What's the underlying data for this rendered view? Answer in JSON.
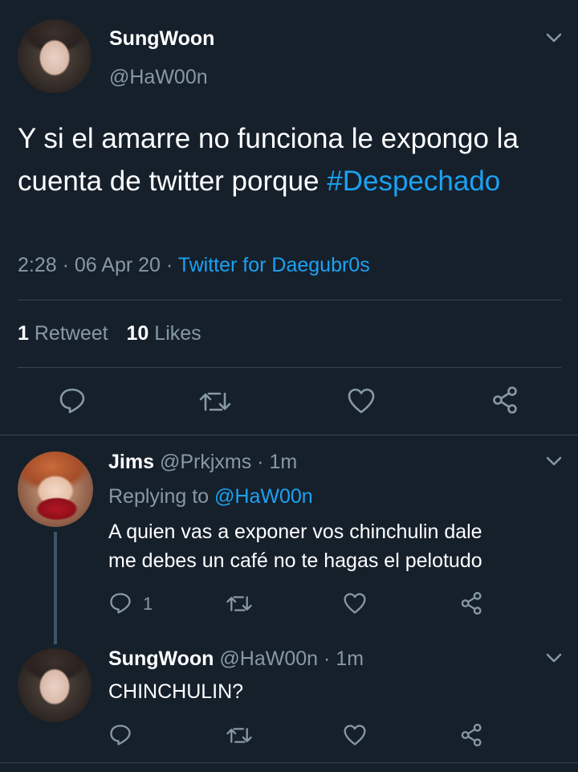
{
  "main_tweet": {
    "display_name": "SungWoon",
    "handle": "@HaW00n",
    "text": "Y si el amarre no funciona le expongo la cuenta de twitter porque",
    "hashtag": "#Despechado",
    "time": "2:28",
    "date": "06 Apr 20",
    "source": "Twitter for Daegubr0s",
    "retweet_count": "1",
    "retweet_label": "Retweet",
    "like_count": "10",
    "like_label": "Likes"
  },
  "replies": [
    {
      "display_name": "Jims",
      "handle": "@Prkjxms",
      "time_ago": "1m",
      "replying_label": "Replying to",
      "replying_handle": "@HaW00n",
      "text_line1": "A quien vas a exponer vos chinchulin dale",
      "text_line2": "me debes un café no te hagas el pelotudo",
      "reply_count": "1"
    },
    {
      "display_name": "SungWoon",
      "handle": "@HaW00n",
      "time_ago": "1m",
      "text": "CHINCHULIN?"
    }
  ],
  "separator": "·",
  "icons": [
    "avatar",
    "chevron-down-icon",
    "reply-icon",
    "retweet-icon",
    "like-icon",
    "share-icon"
  ],
  "colors": {
    "background": "#15202b",
    "link": "#1da1f2",
    "muted": "#8899a6",
    "divider": "#38444d"
  }
}
